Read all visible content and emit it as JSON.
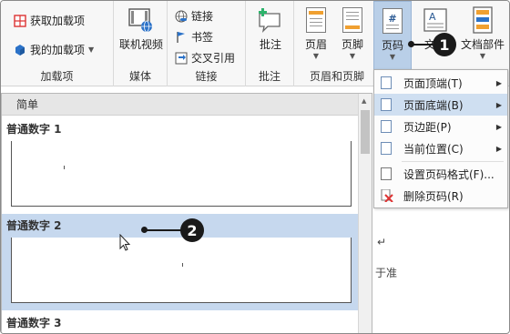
{
  "ribbon": {
    "addins": {
      "get_addins": "获取加载项",
      "my_addins": "我的加载项",
      "label": "加载项"
    },
    "media": {
      "online_video": "联机视频",
      "label": "媒体"
    },
    "links": {
      "link": "链接",
      "bookmark": "书签",
      "cross_ref": "交叉引用",
      "label": "链接"
    },
    "comments": {
      "comment": "批注",
      "label": "批注"
    },
    "header_footer": {
      "header": "页眉",
      "footer": "页脚",
      "page_number": "页码",
      "label": "页眉和页脚"
    },
    "text": {
      "text_box": "文本",
      "quick_parts": "文档部件"
    }
  },
  "menu": {
    "items": [
      {
        "label": "页面顶端(T)",
        "arrow": true,
        "highlighted": false
      },
      {
        "label": "页面底端(B)",
        "arrow": true,
        "highlighted": true
      },
      {
        "label": "页边距(P)",
        "arrow": true,
        "highlighted": false
      },
      {
        "label": "当前位置(C)",
        "arrow": true,
        "highlighted": false
      },
      {
        "label": "设置页码格式(F)...",
        "arrow": false,
        "highlighted": false
      },
      {
        "label": "删除页码(R)",
        "arrow": false,
        "highlighted": false
      }
    ]
  },
  "gallery": {
    "header": "简单",
    "items": [
      {
        "title": "普通数字 1",
        "selected": false
      },
      {
        "title": "普通数字 2",
        "selected": true
      },
      {
        "title": "普通数字 3",
        "selected": false
      }
    ]
  },
  "callouts": {
    "one": "1",
    "two": "2"
  },
  "doc": {
    "return_mark": "↵",
    "fragment": "于准"
  },
  "colors": {
    "accent_blue": "#b9cfe8",
    "menu_highlight": "#cfdff1",
    "gallery_selection": "#c6d8ee",
    "callout": "#1a1a1a"
  }
}
